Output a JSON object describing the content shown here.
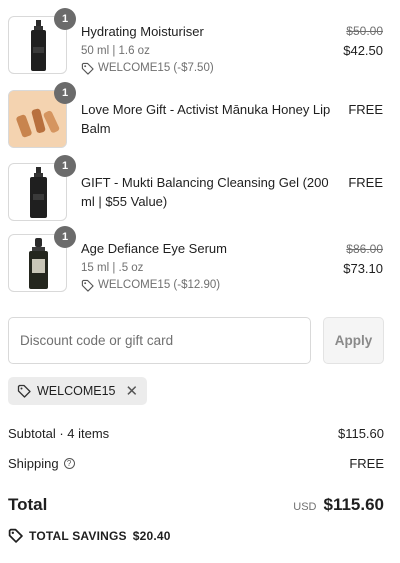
{
  "line_items": [
    {
      "quantity": "1",
      "name": "Hydrating Moisturiser",
      "variant": "50 ml | 1.6 oz",
      "discount": "WELCOME15 (-$7.50)",
      "original_price": "$50.00",
      "price": "$42.50",
      "image_icon": "black-pump-bottle"
    },
    {
      "quantity": "1",
      "name": "Love More Gift - Activist Mānuka Honey Lip Balm",
      "price": "FREE",
      "image_icon": "lip-balm-tubes"
    },
    {
      "quantity": "1",
      "name": "GIFT - Mukti Balancing Cleansing Gel (200 ml | $55 Value)",
      "price": "FREE",
      "image_icon": "black-pump-bottle"
    },
    {
      "quantity": "1",
      "name": "Age Defiance Eye Serum",
      "variant": "15 ml | .5 oz",
      "discount": "WELCOME15 (-$12.90)",
      "original_price": "$86.00",
      "price": "$73.10",
      "image_icon": "dropper-bottle"
    }
  ],
  "discount_form": {
    "placeholder": "Discount code or gift card",
    "apply_label": "Apply"
  },
  "applied_code": "WELCOME15",
  "summary": {
    "subtotal_label": "Subtotal · 4 items",
    "subtotal_value": "$115.60",
    "shipping_label": "Shipping",
    "shipping_value": "FREE",
    "total_label": "Total",
    "currency": "USD",
    "total_value": "$115.60",
    "savings_label": "TOTAL SAVINGS",
    "savings_value": "$20.40"
  },
  "colors": {
    "badge": "#6b6b6b",
    "muted_text": "#707070",
    "border": "#d9d9d9"
  }
}
